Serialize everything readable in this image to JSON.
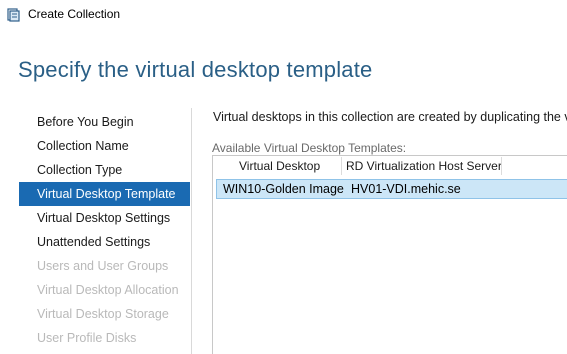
{
  "window": {
    "title": "Create Collection",
    "icon": "server-manager-icon"
  },
  "page": {
    "title": "Specify the virtual desktop template"
  },
  "nav": {
    "items": [
      {
        "label": "Before You Begin",
        "state": "enabled"
      },
      {
        "label": "Collection Name",
        "state": "enabled"
      },
      {
        "label": "Collection Type",
        "state": "enabled"
      },
      {
        "label": "Virtual Desktop Template",
        "state": "active"
      },
      {
        "label": "Virtual Desktop Settings",
        "state": "enabled"
      },
      {
        "label": "Unattended Settings",
        "state": "enabled"
      },
      {
        "label": "Users and User Groups",
        "state": "disabled"
      },
      {
        "label": "Virtual Desktop Allocation",
        "state": "disabled"
      },
      {
        "label": "Virtual Desktop Storage",
        "state": "disabled"
      },
      {
        "label": "User Profile Disks",
        "state": "disabled"
      }
    ]
  },
  "main": {
    "description": "Virtual desktops in this collection are created by duplicating the virt",
    "list_label": "Available Virtual Desktop Templates:",
    "columns": [
      "Virtual Desktop",
      "RD Virtualization Host Server"
    ],
    "rows": [
      {
        "virtual_desktop": "WIN10-Golden Image",
        "host_server": "HV01-VDI.mehic.se",
        "selected": true
      }
    ]
  },
  "colors": {
    "title_blue": "#2a5f86",
    "selection_blue": "#1a6ab2",
    "row_highlight": "#cce6f7",
    "disabled_text": "#b9b9b9"
  }
}
